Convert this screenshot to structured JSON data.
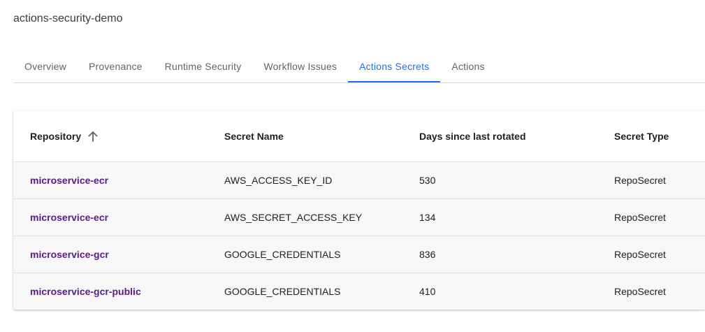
{
  "header": {
    "org_title": "actions-security-demo"
  },
  "tabs": [
    {
      "label": "Overview",
      "active": false
    },
    {
      "label": "Provenance",
      "active": false
    },
    {
      "label": "Runtime Security",
      "active": false
    },
    {
      "label": "Workflow Issues",
      "active": false
    },
    {
      "label": "Actions Secrets",
      "active": true
    },
    {
      "label": "Actions",
      "active": false
    }
  ],
  "table": {
    "columns": [
      {
        "label": "Repository",
        "sort": "ascending"
      },
      {
        "label": "Secret Name"
      },
      {
        "label": "Days since last rotated"
      },
      {
        "label": "Secret Type"
      }
    ],
    "rows": [
      {
        "repository": "microservice-ecr",
        "secret_name": "AWS_ACCESS_KEY_ID",
        "days": "530",
        "secret_type": "RepoSecret"
      },
      {
        "repository": "microservice-ecr",
        "secret_name": "AWS_SECRET_ACCESS_KEY",
        "days": "134",
        "secret_type": "RepoSecret"
      },
      {
        "repository": "microservice-gcr",
        "secret_name": "GOOGLE_CREDENTIALS",
        "days": "836",
        "secret_type": "RepoSecret"
      },
      {
        "repository": "microservice-gcr-public",
        "secret_name": "GOOGLE_CREDENTIALS",
        "days": "410",
        "secret_type": "RepoSecret"
      }
    ]
  },
  "colors": {
    "accent": "#1a73e8",
    "link": "#5b1a8c",
    "row_background": "#f7f7f8"
  },
  "icons": {
    "sort": "arrow-up-icon"
  }
}
